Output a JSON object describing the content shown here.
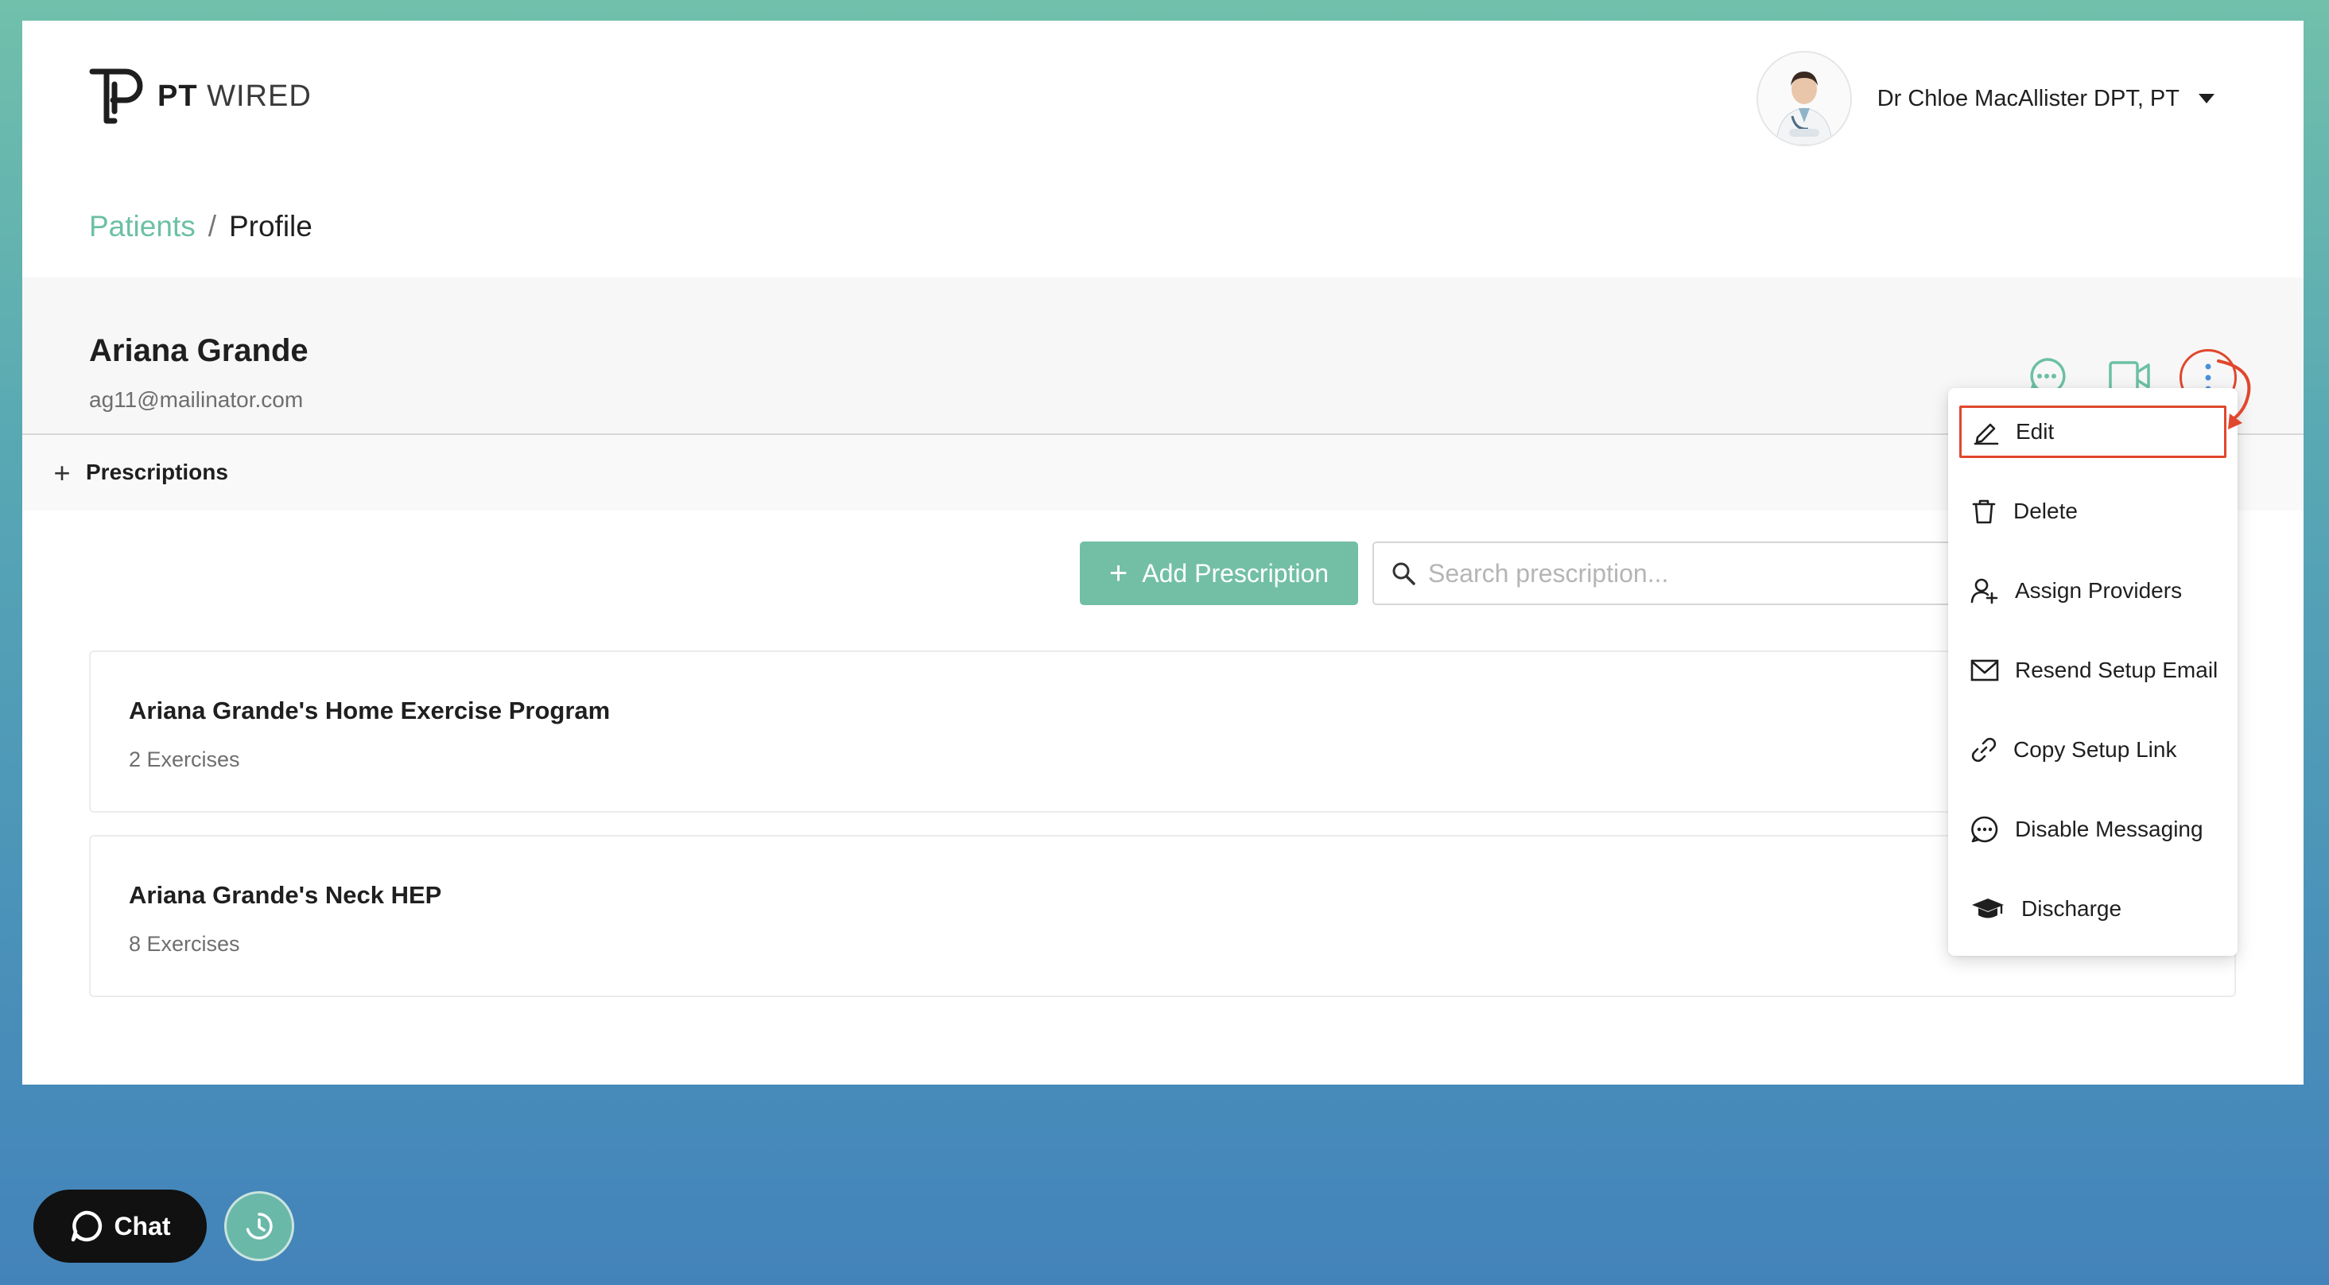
{
  "brand": {
    "name_bold": "PT",
    "name_light": "WIRED"
  },
  "user": {
    "name": "Dr Chloe MacAllister DPT, PT"
  },
  "breadcrumb": {
    "parent": "Patients",
    "separator": "/",
    "current": "Profile"
  },
  "patient": {
    "name": "Ariana Grande",
    "email": "ag11@mailinator.com"
  },
  "prescriptions": {
    "section_title": "Prescriptions",
    "add_label": "Add Prescription",
    "search_placeholder": "Search prescription...",
    "programs": [
      {
        "title": "Ariana Grande's Home Exercise Program",
        "count": "2 Exercises"
      },
      {
        "title": "Ariana Grande's Neck HEP",
        "count": "8 Exercises"
      }
    ]
  },
  "menu": {
    "items": [
      {
        "label": "Edit",
        "icon": "pencil-icon"
      },
      {
        "label": "Delete",
        "icon": "trash-icon"
      },
      {
        "label": "Assign Providers",
        "icon": "assign-user-icon"
      },
      {
        "label": "Resend Setup Email",
        "icon": "envelope-icon"
      },
      {
        "label": "Copy Setup Link",
        "icon": "link-icon"
      },
      {
        "label": "Disable Messaging",
        "icon": "message-icon"
      },
      {
        "label": "Discharge",
        "icon": "graduation-cap-icon"
      }
    ]
  },
  "widgets": {
    "chat_label": "Chat"
  },
  "colors": {
    "accent": "#6cc0a4",
    "button": "#72bfa6",
    "annotation": "#e0472e",
    "dots": "#4a90d9"
  }
}
